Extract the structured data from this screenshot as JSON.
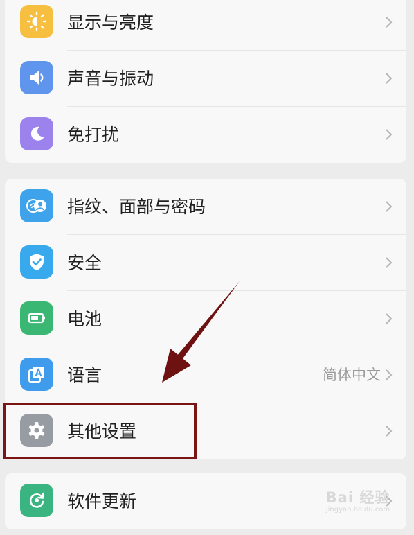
{
  "groups": [
    {
      "items": [
        {
          "label": "显示与亮度",
          "icon": "brightness-icon",
          "color": "#f6bf40"
        },
        {
          "label": "声音与振动",
          "icon": "speaker-icon",
          "color": "#5f95ec"
        },
        {
          "label": "免打扰",
          "icon": "moon-icon",
          "color": "#9c82ec"
        }
      ]
    },
    {
      "items": [
        {
          "label": "指纹、面部与密码",
          "icon": "fingerprint-face-icon",
          "color": "#3fa3ec"
        },
        {
          "label": "安全",
          "icon": "shield-check-icon",
          "color": "#38a9ec"
        },
        {
          "label": "电池",
          "icon": "battery-icon",
          "color": "#3ab772"
        },
        {
          "label": "语言",
          "value": "简体中文",
          "icon": "language-icon",
          "color": "#3f9bec"
        },
        {
          "label": "其他设置",
          "icon": "gear-icon",
          "color": "#979ca3"
        }
      ]
    },
    {
      "items": [
        {
          "label": "软件更新",
          "icon": "update-icon",
          "color": "#3ab480"
        }
      ]
    }
  ],
  "annotation": {
    "box_color": "#7b1515",
    "arrow_color": "#6e1111"
  },
  "watermark": {
    "main": "Bai 经验",
    "sub": "jingyan.baidu.com"
  }
}
